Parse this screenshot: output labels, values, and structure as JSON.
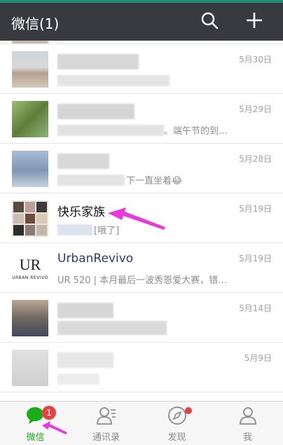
{
  "header": {
    "title": "微信(1)"
  },
  "chats": [
    {
      "name": "",
      "preview": "",
      "date": "5月30日"
    },
    {
      "name": "",
      "preview": "。端午节的到…",
      "date": "5月29日"
    },
    {
      "name": "",
      "preview": "下一直坐着😂",
      "date": "5月28日"
    },
    {
      "name": "快乐家族",
      "preview": "[哦了]",
      "date": "5月19日"
    },
    {
      "name": "UrbanRevivo",
      "preview": "UR 520 | 本月最后一波秀恩爱大赛，错…",
      "date": "5月19日"
    },
    {
      "name": "",
      "preview": "",
      "date": "5月14日"
    },
    {
      "name": "",
      "preview": "",
      "date": "5月9日"
    }
  ],
  "logo": {
    "monogram": "UR",
    "wordmark": "URBAN REVIVO"
  },
  "tabs": [
    {
      "label": "微信",
      "badge": "1"
    },
    {
      "label": "通讯录"
    },
    {
      "label": "发现"
    },
    {
      "label": "我"
    }
  ],
  "colors": {
    "header": "#393a3f",
    "active": "#1aad19",
    "badge": "#e64340",
    "annotation": "#e83adb"
  }
}
